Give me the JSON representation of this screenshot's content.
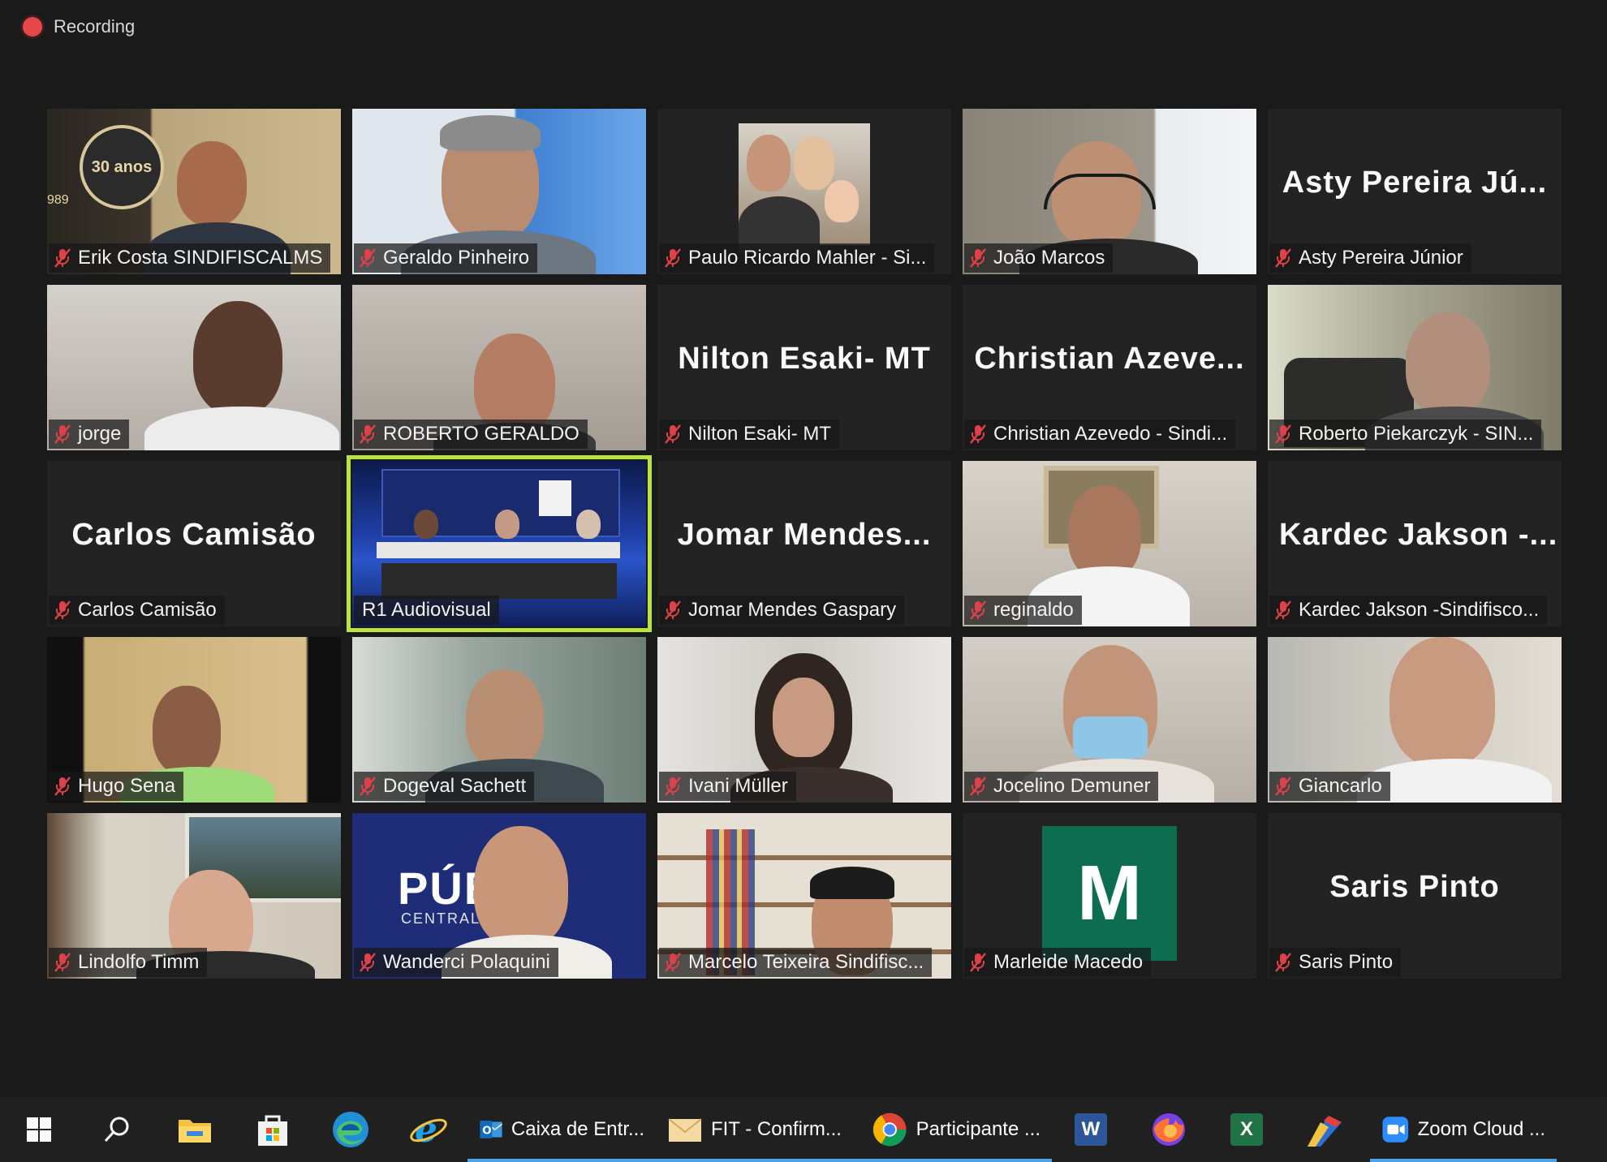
{
  "recording": {
    "label": "Recording"
  },
  "participants": [
    {
      "id": "erik",
      "name": "Erik Costa SINDIFISCALMS",
      "video": true,
      "bg": "#6b5a3a"
    },
    {
      "id": "geraldo",
      "name": "Geraldo Pinheiro",
      "video": true,
      "bg": "#8ea8c8"
    },
    {
      "id": "paulo",
      "name": "Paulo Ricardo Mahler - Si...",
      "video": true,
      "bg": "#232323"
    },
    {
      "id": "joao",
      "name": "João Marcos",
      "video": true,
      "bg": "#7d7b76"
    },
    {
      "id": "asty",
      "name": "Asty Pereira Júnior",
      "video": false,
      "display": "Asty  Pereira  Jú..."
    },
    {
      "id": "jorge",
      "name": "jorge",
      "video": true,
      "bg": "#b9b4ac"
    },
    {
      "id": "roberto-g",
      "name": "ROBERTO GERALDO",
      "video": true,
      "bg": "#a9a29a"
    },
    {
      "id": "nilton",
      "name": "Nilton Esaki- MT",
      "video": false,
      "display": "Nilton Esaki- MT"
    },
    {
      "id": "christian",
      "name": "Christian Azevedo - Sindi...",
      "video": false,
      "display": "Christian  Azeve..."
    },
    {
      "id": "roberto-p",
      "name": "Roberto Piekarczyk - SIN...",
      "video": true,
      "bg": "#8a8572"
    },
    {
      "id": "carlos",
      "name": "Carlos Camisão",
      "video": false,
      "display": "Carlos Camisão"
    },
    {
      "id": "r1",
      "name": "R1 Audiovisual",
      "video": true,
      "bg": "#13235a",
      "active": true
    },
    {
      "id": "jomar",
      "name": "Jomar Mendes Gaspary",
      "video": false,
      "display": "Jomar  Mendes..."
    },
    {
      "id": "reginaldo",
      "name": "reginaldo",
      "video": true,
      "bg": "#c7c1b6"
    },
    {
      "id": "kardec",
      "name": "Kardec Jakson -Sindifisco...",
      "video": false,
      "display": "Kardec  Jakson  -..."
    },
    {
      "id": "hugo",
      "name": "Hugo Sena",
      "video": true,
      "bg": "#c7ad7a"
    },
    {
      "id": "dogeval",
      "name": "Dogeval Sachett",
      "video": true,
      "bg": "#7f8f86"
    },
    {
      "id": "ivani",
      "name": "Ivani Müller",
      "video": true,
      "bg": "#cfc9c4"
    },
    {
      "id": "jocelino",
      "name": "Jocelino Demuner",
      "video": true,
      "bg": "#b7b0a6"
    },
    {
      "id": "giancarlo",
      "name": "Giancarlo",
      "video": true,
      "bg": "#c9c3b8"
    },
    {
      "id": "lindolfo",
      "name": "Lindolfo Timm",
      "video": true,
      "bg": "#b0a48e"
    },
    {
      "id": "wanderci",
      "name": "Wanderci Polaquini",
      "video": true,
      "bg": "#1f2d78"
    },
    {
      "id": "marcelo",
      "name": "Marcelo Teixeira Sindifisc...",
      "video": true,
      "bg": "#d2cbc0"
    },
    {
      "id": "marleide",
      "name": "Marleide Macedo",
      "video": false,
      "avatar_letter": "M"
    },
    {
      "id": "saris",
      "name": "Saris Pinto",
      "video": false,
      "display": "Saris Pinto"
    }
  ],
  "tile_texts": {
    "erik_badge": "30 anos",
    "erik_year": "989",
    "wanderci_sign": "PÚB   A",
    "wanderci_sign_sub": "CENTRAL     DOR"
  },
  "taskbar": {
    "icons": [
      "windows-start-icon",
      "search-icon",
      "file-explorer-icon",
      "store-icon",
      "edge-icon",
      "internet-explorer-icon"
    ],
    "apps": [
      {
        "id": "outlook",
        "label": "Caixa de Entr...",
        "open": true
      },
      {
        "id": "mail",
        "label": "FIT - Confirm...",
        "open": true
      },
      {
        "id": "chrome",
        "label": "Participante ...",
        "open": true
      }
    ],
    "pinned": [
      "word-icon",
      "firefox-icon",
      "excel-icon",
      "paint-icon"
    ],
    "zoom": {
      "label": "Zoom Cloud ...",
      "open": true
    }
  }
}
